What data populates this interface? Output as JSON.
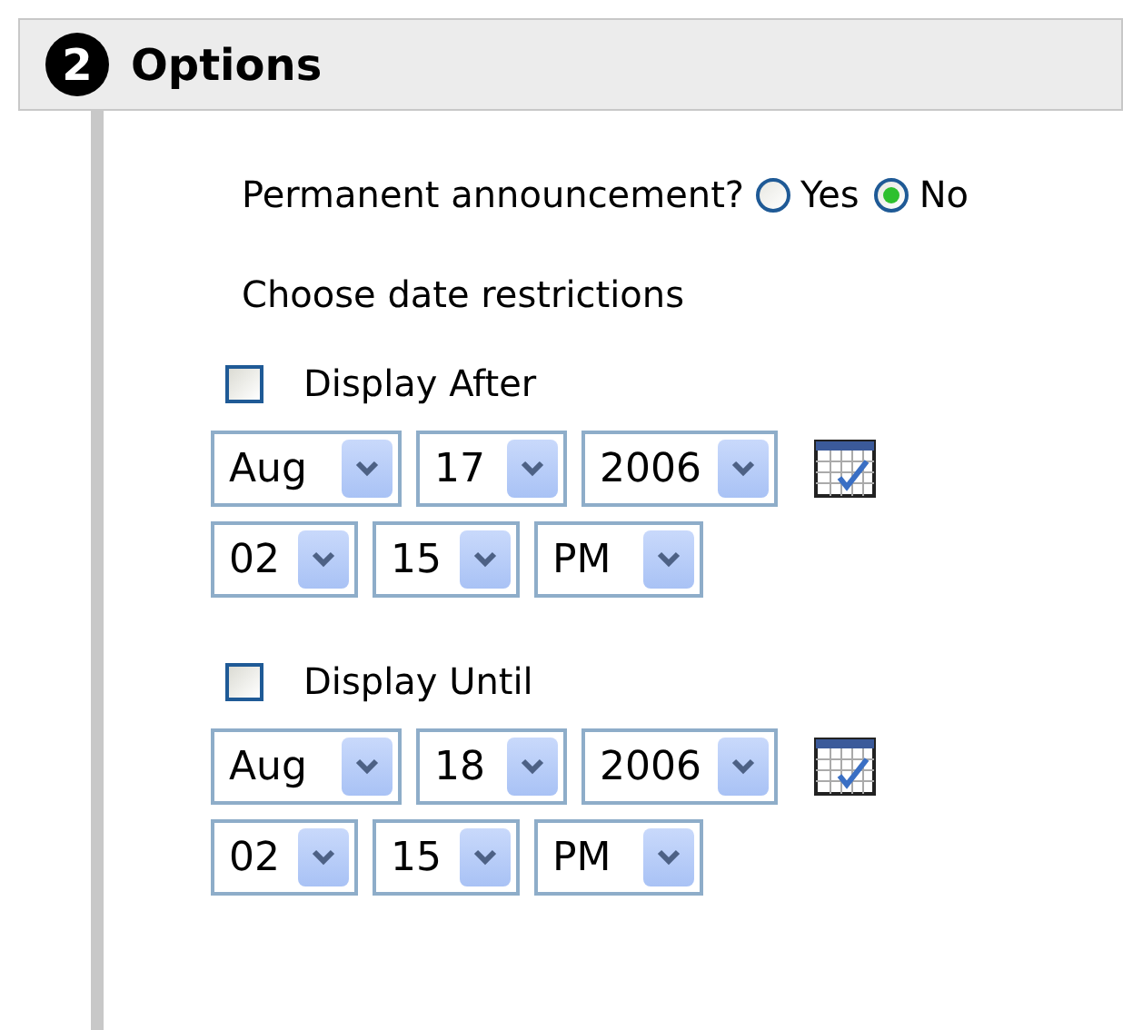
{
  "section": {
    "number": "2",
    "title": "Options"
  },
  "permanent": {
    "label": "Permanent announcement?",
    "options": [
      {
        "label": "Yes",
        "selected": false
      },
      {
        "label": "No",
        "selected": true
      }
    ]
  },
  "date_heading": "Choose date restrictions",
  "restrictions": [
    {
      "label": "Display After",
      "checked": false,
      "date": [
        "Aug",
        "17",
        "2006"
      ],
      "time": [
        "02",
        "15",
        "PM"
      ]
    },
    {
      "label": "Display Until",
      "checked": false,
      "date": [
        "Aug",
        "18",
        "2006"
      ],
      "time": [
        "02",
        "15",
        "PM"
      ]
    }
  ]
}
